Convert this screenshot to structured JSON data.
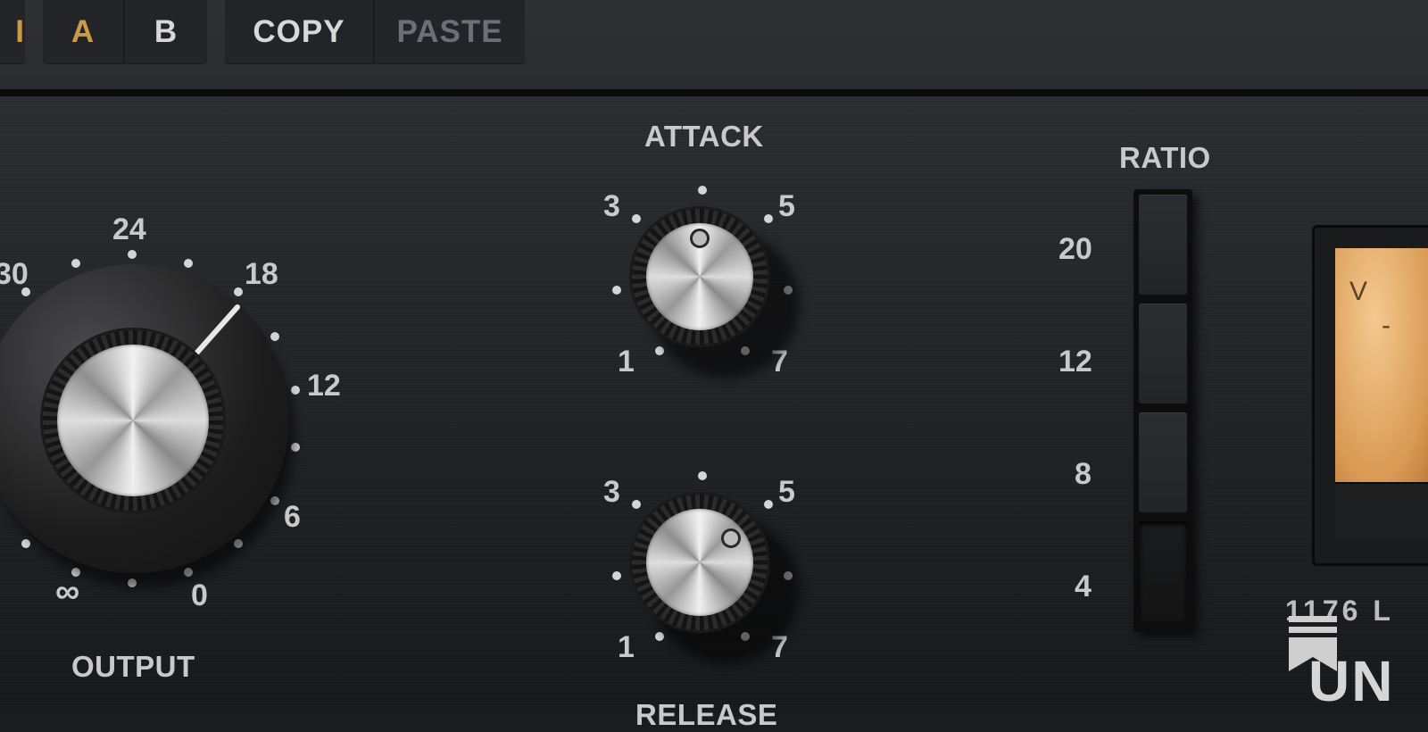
{
  "toolbar": {
    "partial_left": "I",
    "a_label": "A",
    "b_label": "B",
    "copy_label": "COPY",
    "paste_label": "PASTE"
  },
  "output": {
    "label": "OUTPUT",
    "scale": [
      "30",
      "24",
      "18",
      "12",
      "6",
      "0",
      "∞"
    ]
  },
  "attack": {
    "label": "ATTACK",
    "scale": [
      "3",
      "5",
      "1",
      "7"
    ]
  },
  "release": {
    "label": "RELEASE",
    "scale": [
      "3",
      "5",
      "1",
      "7"
    ]
  },
  "ratio": {
    "label": "RATIO",
    "options": [
      "20",
      "12",
      "8",
      "4"
    ],
    "selected": "4"
  },
  "meter": {
    "text_top": "V",
    "text_mid": "-"
  },
  "brand": {
    "model": "1176 L",
    "name": "UN"
  },
  "colors": {
    "ab_accent": "#c99a47",
    "meter_face": "#e0a35e"
  }
}
